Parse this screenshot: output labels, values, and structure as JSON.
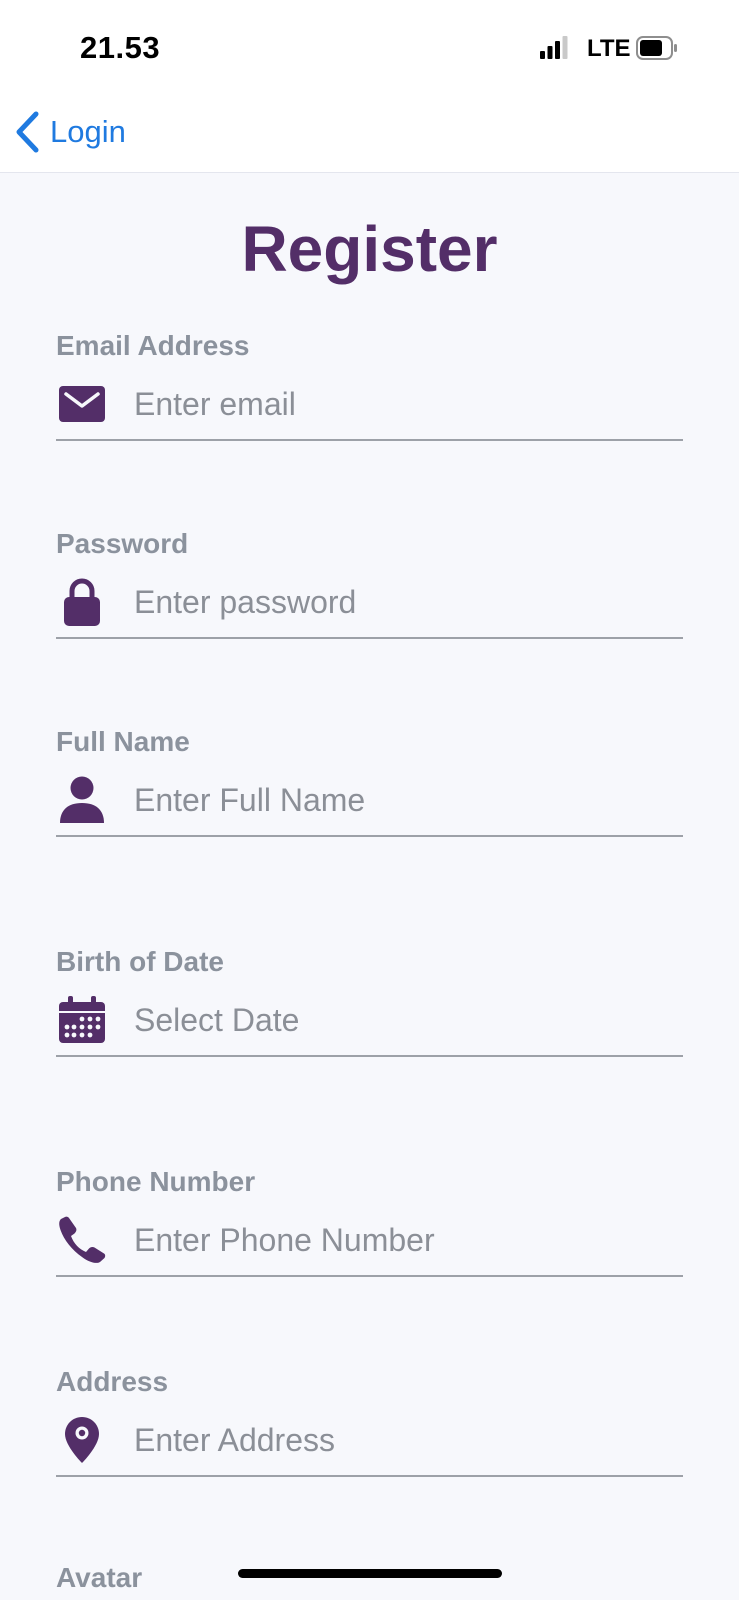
{
  "status_bar": {
    "time": "21.53",
    "network": "LTE",
    "signal_bars": 3,
    "battery_level": 0.75,
    "icons": [
      "signal-icon",
      "battery-icon"
    ]
  },
  "nav": {
    "back_label": "Login",
    "back_icon": "chevron-left-icon"
  },
  "page": {
    "title": "Register"
  },
  "form": {
    "email": {
      "label": "Email Address",
      "placeholder": "Enter email",
      "icon": "envelope-icon"
    },
    "password": {
      "label": "Password",
      "placeholder": "Enter password",
      "icon": "lock-icon"
    },
    "full_name": {
      "label": "Full Name",
      "placeholder": "Enter Full Name",
      "icon": "user-icon"
    },
    "birth_date": {
      "label": "Birth of Date",
      "placeholder": "Select Date",
      "icon": "calendar-icon"
    },
    "phone": {
      "label": "Phone Number",
      "placeholder": "Enter Phone Number",
      "icon": "phone-icon"
    },
    "address": {
      "label": "Address",
      "placeholder": "Enter Address",
      "icon": "map-pin-icon"
    },
    "avatar": {
      "label": "Avatar"
    }
  },
  "colors": {
    "accent": "#532e68",
    "link": "#1f7ae0",
    "label": "#8b929d",
    "background": "#f7f8fc"
  }
}
